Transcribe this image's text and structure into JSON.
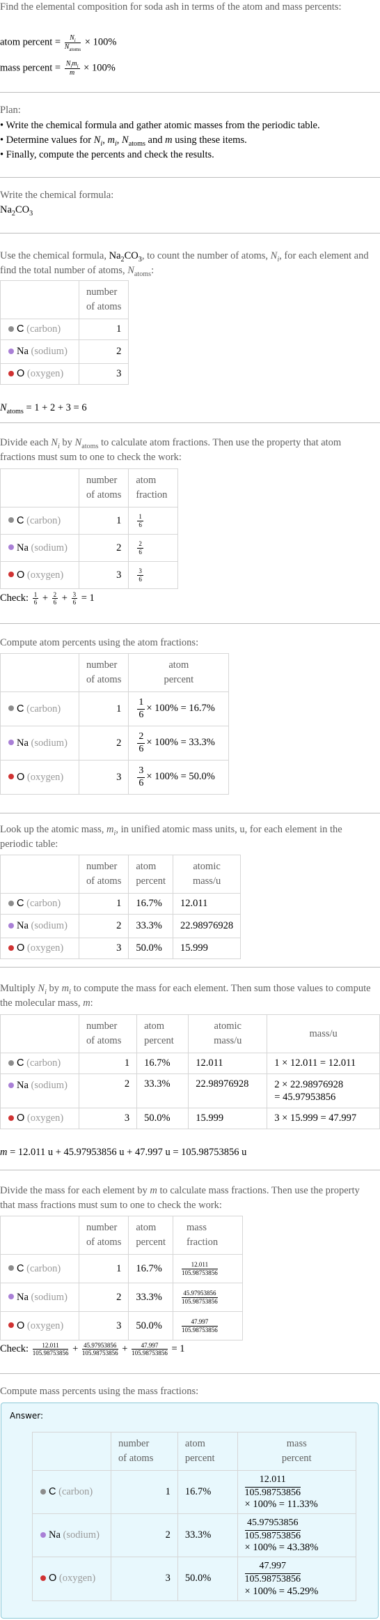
{
  "intro": {
    "question": "Find the elemental composition for soda ash in terms of the atom and mass percents:",
    "atom_percent_label": "atom percent",
    "mass_percent_label": "mass percent",
    "times_100": "× 100%",
    "eq": "="
  },
  "plan": {
    "title": "Plan:",
    "bullets": [
      "• Write the chemical formula and gather atomic masses from the periodic table.",
      "• Determine values for",
      "• Finally, compute the percents and check the results."
    ],
    "bullet2_tail": "using these items.",
    "and": "and"
  },
  "formula_step": {
    "text": "Write the chemical formula:",
    "formula_parts": [
      "Na",
      "2",
      "CO",
      "3"
    ]
  },
  "count_step": {
    "text_a": "Use the chemical formula,",
    "text_b": ", to count the number of atoms,",
    "text_c": ", for each element and find the total number of atoms,",
    "total_equation": "= 1 + 2 + 3 = 6"
  },
  "headers": {
    "number_of_atoms": [
      "number",
      "of atoms"
    ],
    "atom_fraction": [
      "atom",
      "fraction"
    ],
    "atom_percent": [
      "atom",
      "percent"
    ],
    "atomic_mass": [
      "atomic",
      "mass/u"
    ],
    "mass_u": "mass/u",
    "mass_fraction": [
      "mass",
      "fraction"
    ],
    "mass_percent": [
      "mass",
      "percent"
    ]
  },
  "elements": [
    {
      "symbol": "C",
      "name": "(carbon)",
      "color": "#8c8c8c",
      "count": "1",
      "fraction_num": "1",
      "fraction_den": "6",
      "atom_percent_calc": "× 100% = 16.7%",
      "atom_percent": "16.7%",
      "atomic_mass": "12.011",
      "mass_calc": "1 × 12.011 = 12.011",
      "mass_calc_2": "",
      "mass": "12.011",
      "mass_percent_calc": "× 100% = 11.33%"
    },
    {
      "symbol": "Na",
      "name": "(sodium)",
      "color": "#a97fd6",
      "count": "2",
      "fraction_num": "2",
      "fraction_den": "6",
      "atom_percent_calc": "× 100% = 33.3%",
      "atom_percent": "33.3%",
      "atomic_mass": "22.98976928",
      "mass_calc": "2 × 22.98976928",
      "mass_calc_2": "= 45.97953856",
      "mass": "45.97953856",
      "mass_percent_calc": "× 100% = 43.38%"
    },
    {
      "symbol": "O",
      "name": "(oxygen)",
      "color": "#d03232",
      "count": "3",
      "fraction_num": "3",
      "fraction_den": "6",
      "atom_percent_calc": "× 100% = 50.0%",
      "atom_percent": "50.0%",
      "atomic_mass": "15.999",
      "mass_calc": "3 × 15.999 = 47.997",
      "mass_calc_2": "",
      "mass": "47.997",
      "mass_percent_calc": "× 100% = 45.29%"
    }
  ],
  "fraction_step": {
    "text_a": "Divide each",
    "text_b": "by",
    "text_c": "to calculate atom fractions. Then use the property that atom fractions must sum to one to check the work:",
    "check_label": "Check:",
    "plus": "+",
    "check_result": "= 1"
  },
  "atom_percent_step": {
    "text": "Compute atom percents using the atom fractions:"
  },
  "lookup_step": {
    "text_a": "Look up the atomic mass,",
    "text_b": ", in unified atomic mass units, u, for each element in the periodic table:"
  },
  "mass_step": {
    "text_a": "Multiply",
    "text_b": "by",
    "text_c": "to compute the mass for each element. Then sum those values to compute the molecular mass,",
    "colon": ":",
    "total_equation": "= 12.011 u + 45.97953856 u + 47.997 u = 105.98753856 u"
  },
  "mass_fraction_step": {
    "text_a": "Divide the mass for each element by",
    "text_b": "to calculate mass fractions. Then use the property that mass fractions must sum to one to check the work:",
    "molecular_mass": "105.98753856",
    "check_label": "Check:",
    "plus": "+",
    "check_result": "= 1"
  },
  "mass_percent_step": {
    "text": "Compute mass percents using the mass fractions:",
    "answer_label": "Answer:"
  },
  "symbols": {
    "N": "N",
    "i": "i",
    "atoms": "atoms",
    "m": "m"
  }
}
